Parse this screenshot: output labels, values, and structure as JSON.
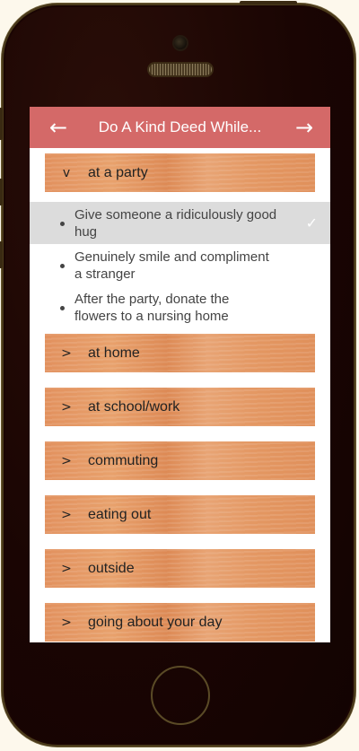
{
  "app": {
    "title": "Do A Kind Deed While...",
    "back_icon": "arrow-left-icon",
    "forward_icon": "arrow-right-icon",
    "back_glyph": "←",
    "forward_glyph": "→"
  },
  "colors": {
    "appbar": "#d46968",
    "selected_row": "#dcdcdc"
  },
  "categories": [
    {
      "label": "at a party",
      "chevron": "v",
      "expanded": true
    },
    {
      "label": "at home",
      "chevron": ">",
      "expanded": false
    },
    {
      "label": "at school/work",
      "chevron": ">",
      "expanded": false
    },
    {
      "label": "commuting",
      "chevron": ">",
      "expanded": false
    },
    {
      "label": "eating out",
      "chevron": ">",
      "expanded": false
    },
    {
      "label": "outside",
      "chevron": ">",
      "expanded": false
    },
    {
      "label": "going about your day",
      "chevron": ">",
      "expanded": false
    }
  ],
  "party_items": [
    {
      "line1": "Give someone a ridiculously good",
      "line2": "hug",
      "selected": true,
      "check": "✓"
    },
    {
      "line1": "Genuinely smile and compliment",
      "line2": "a stranger",
      "selected": false,
      "check": ""
    },
    {
      "line1": "After the party, donate the",
      "line2": "flowers to a nursing home",
      "selected": false,
      "check": ""
    }
  ]
}
